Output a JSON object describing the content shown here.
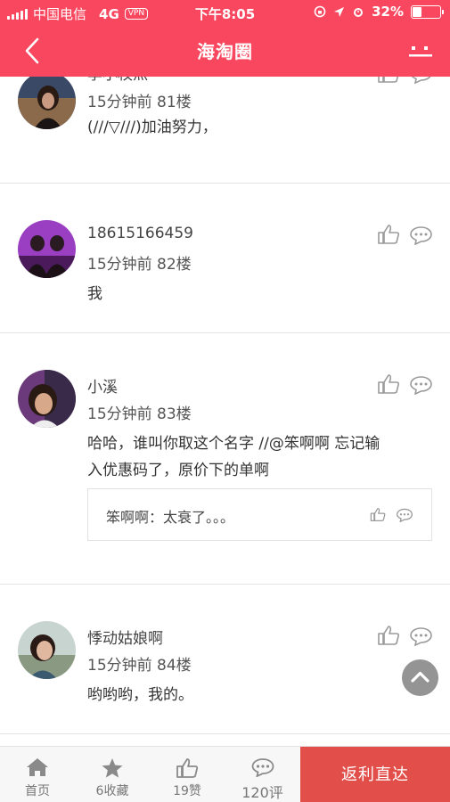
{
  "status_bar": {
    "carrier": "中国电信",
    "network": "4G",
    "vpn": "VPN",
    "time": "下午8:05",
    "battery_percent": "32%",
    "battery_level": 0.32
  },
  "nav": {
    "title": "海淘圈",
    "back_icon": "chevron-left-icon",
    "more_icon": "more-icon"
  },
  "posts": [
    {
      "username": "李小枚灬",
      "time": "15分钟前",
      "floor": "81楼",
      "content": "(///▽///)加油努力，"
    },
    {
      "username": "18615166459",
      "time": "15分钟前",
      "floor": "82楼",
      "content": "我"
    },
    {
      "username": "小溪",
      "time": "15分钟前",
      "floor": "83楼",
      "content_line1": "哈哈，谁叫你取这个名字 //@笨啊啊 忘记输",
      "content_line2": "入优惠码了，原价下的单啊",
      "reply": {
        "author": "笨啊啊",
        "separator": "：",
        "text": "太衰了。。。"
      }
    },
    {
      "username": "悸动姑娘啊",
      "time": "15分钟前",
      "floor": "84楼",
      "content": "哟哟哟，我的。"
    }
  ],
  "tab_bar": {
    "home": "首页",
    "favorites": "6收藏",
    "likes": "19赞",
    "comments": "120评",
    "cta": "返利直达"
  },
  "colors": {
    "brand": "#f8475e",
    "cta": "#e24f4a",
    "icon_gray": "#9a9a9a"
  }
}
